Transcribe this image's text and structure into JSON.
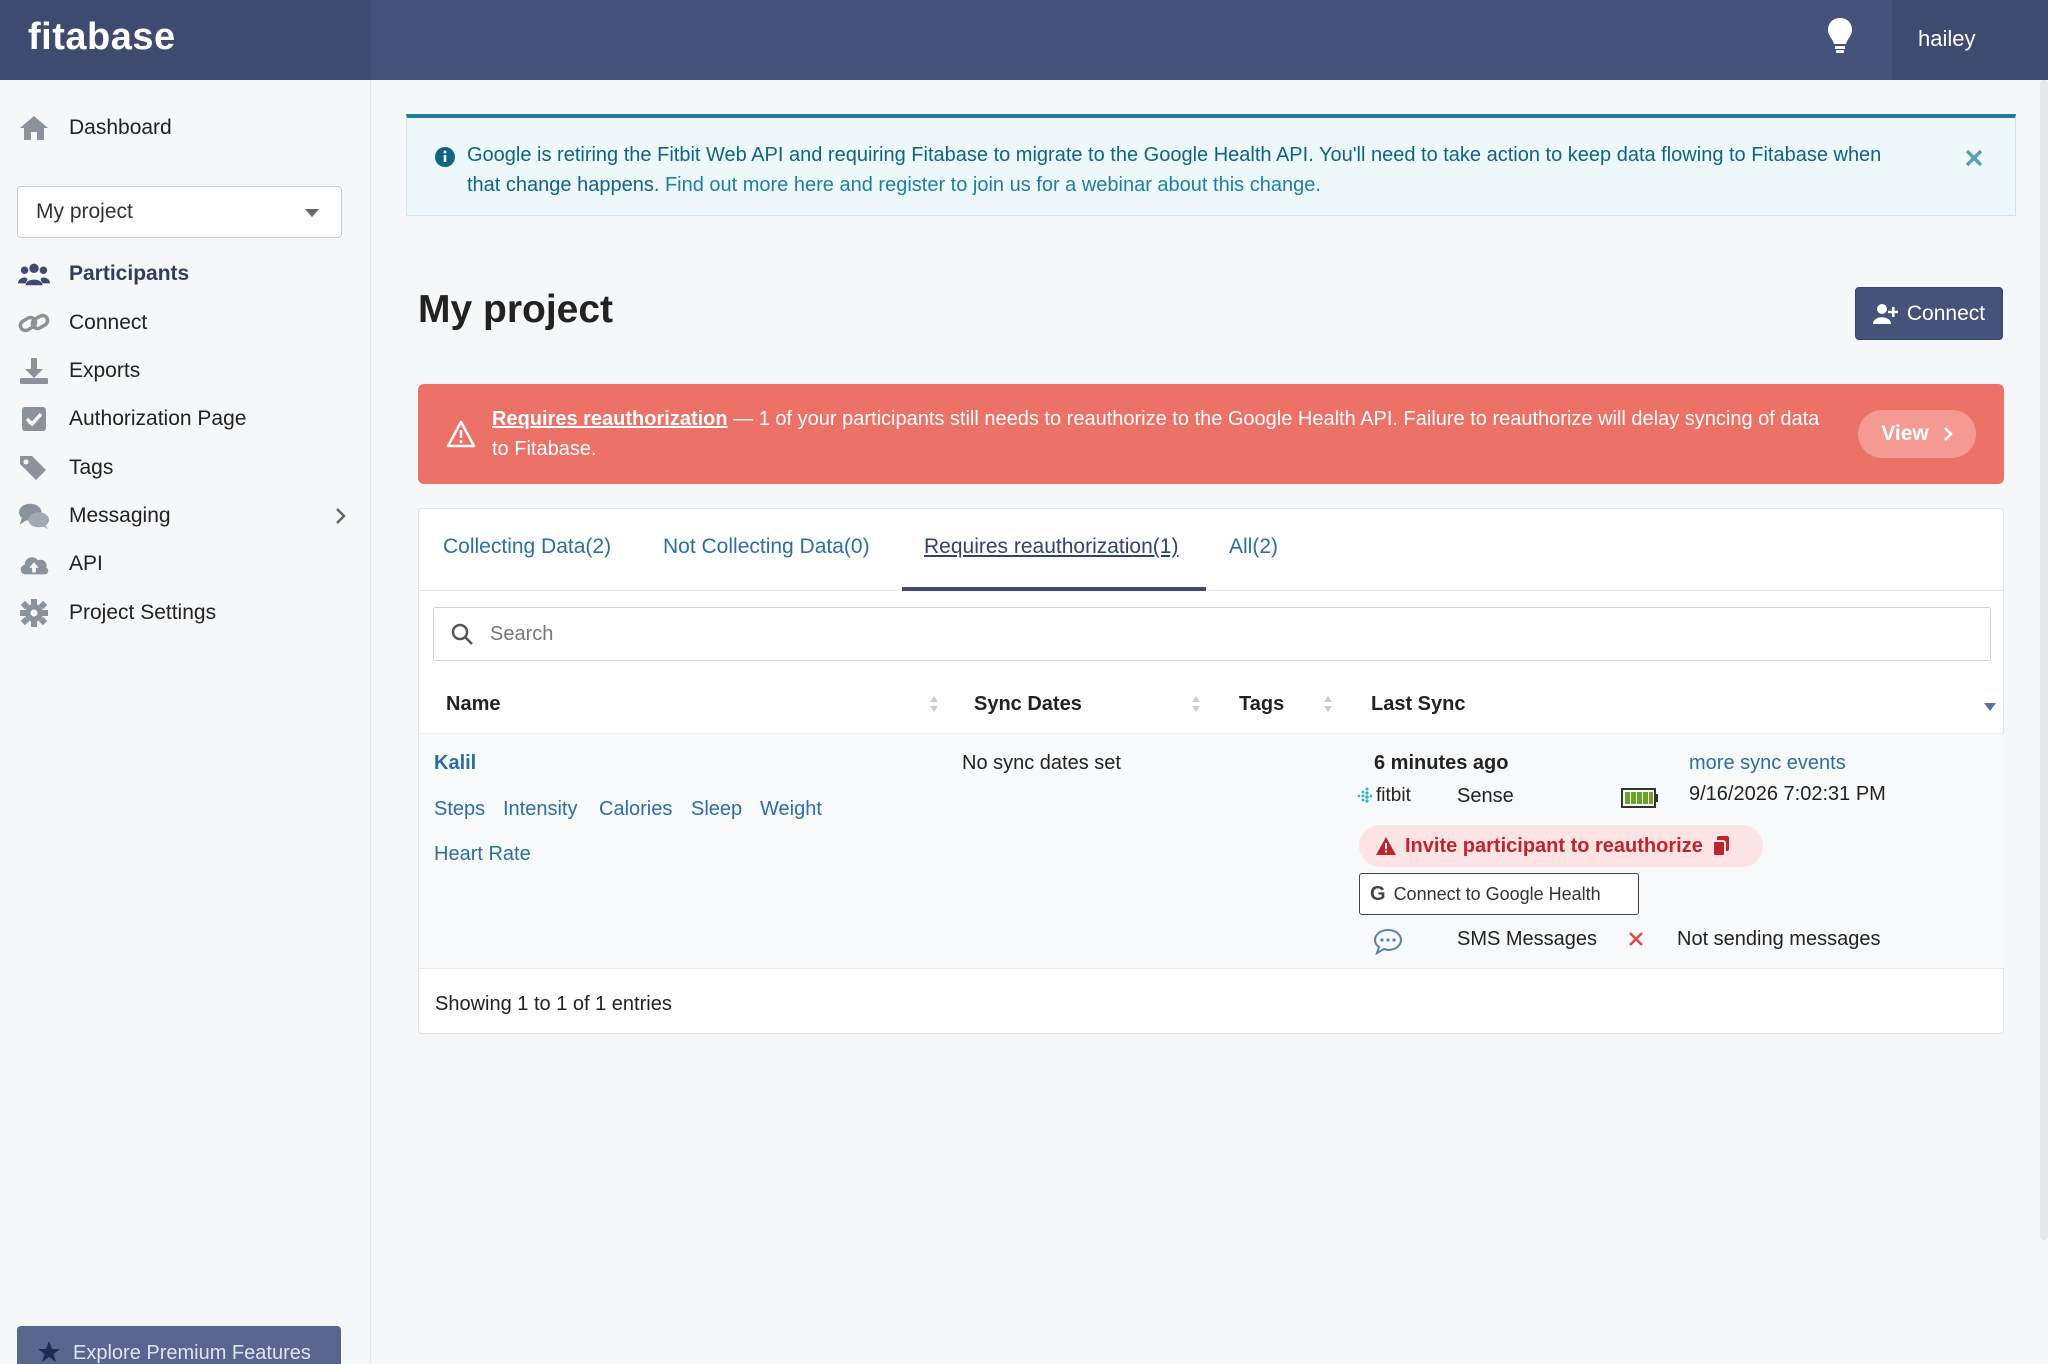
{
  "app": {
    "brand": "fitabase",
    "user": "hailey"
  },
  "sidebar": {
    "dashboard": "Dashboard",
    "project_select": "My project",
    "items": [
      {
        "label": "Participants",
        "icon": "users-icon"
      },
      {
        "label": "Connect",
        "icon": "link-icon"
      },
      {
        "label": "Exports",
        "icon": "download-icon"
      },
      {
        "label": "Authorization Page",
        "icon": "check-square-icon"
      },
      {
        "label": "Tags",
        "icon": "tags-icon"
      },
      {
        "label": "Messaging",
        "icon": "comments-icon"
      },
      {
        "label": "API",
        "icon": "cloud-upload-icon"
      },
      {
        "label": "Project Settings",
        "icon": "gear-icon"
      }
    ],
    "premium": "Explore Premium Features"
  },
  "info_alert": {
    "text": "Google is retiring the Fitbit Web API and requiring Fitabase to migrate to the Google Health API. You'll need to take action to keep data flowing to Fitabase when that change happens.",
    "link": "Find out more here and register to join us for a webinar about this change."
  },
  "main": {
    "title": "My project",
    "connect_button": "Connect"
  },
  "danger_alert": {
    "link": "Requires reauthorization",
    "text": " — 1 of your participants still needs to reauthorize to the Google Health API. Failure to reauthorize will delay syncing of data to Fitabase.",
    "view_button": "View"
  },
  "tabs": [
    {
      "label": "Collecting Data(2)"
    },
    {
      "label": "Not Collecting Data(0)"
    },
    {
      "label": "Requires reauthorization(1)"
    },
    {
      "label": "All(2)"
    }
  ],
  "search": {
    "placeholder": "Search"
  },
  "table": {
    "headers": {
      "name": "Name",
      "sync_dates": "Sync Dates",
      "tags": "Tags",
      "last_sync": "Last Sync"
    },
    "row": {
      "name": "Kalil",
      "metrics": [
        "Steps",
        "Intensity",
        "Calories",
        "Sleep",
        "Weight",
        "Heart Rate"
      ],
      "sync_dates": "No sync dates set",
      "last_sync": "6 minutes ago",
      "more_sync": "more sync events",
      "device_brand": "fitbit",
      "device": "Sense",
      "timestamp": "9/16/2026 7:02:31 PM",
      "invite": "Invite participant to reauthorize",
      "google_health": "Connect to Google Health",
      "sms_label": "SMS Messages",
      "sms_status": "Not sending messages"
    },
    "footer": "Showing 1 to 1 of 1 entries"
  },
  "colors": {
    "nav": "#455279",
    "danger": "#ec7167",
    "link": "#2b6ea5",
    "info": "#0e6487"
  }
}
